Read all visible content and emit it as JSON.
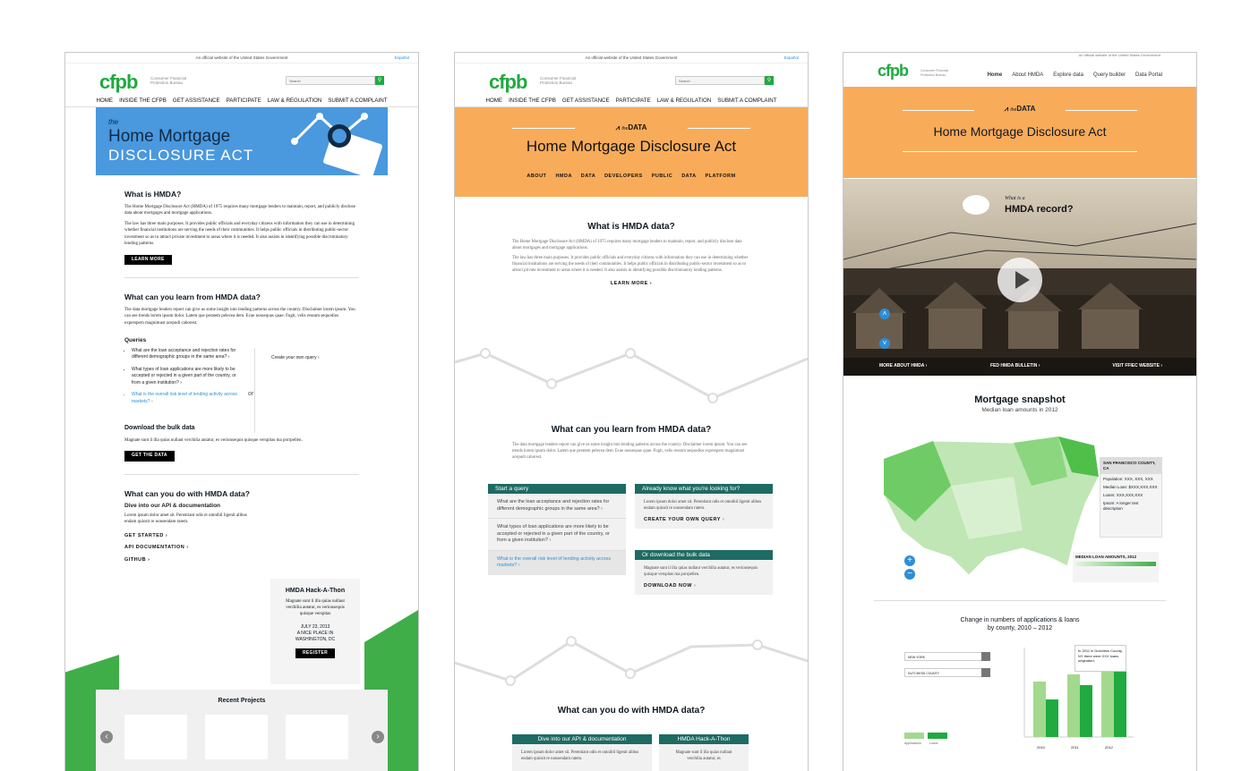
{
  "common": {
    "gov_banner": "An official website of the United States Government",
    "espanol": "Español",
    "logo": "cfpb",
    "logo_sub": "Consumer Financial Protection Bureau",
    "search_placeholder": "Search",
    "nav": [
      "HOME",
      "INSIDE THE CFPB",
      "GET ASSISTANCE",
      "PARTICIPATE",
      "LAW & REGULATION",
      "SUBMIT A COMPLAINT"
    ]
  },
  "panel1": {
    "hero_the": "the",
    "hero_title1": "Home Mortgage",
    "hero_title2": "DISCLOSURE ACT",
    "what_heading": "What is HMDA?",
    "what_p1": "The Home Mortgage Disclosure Act (HMDA) of 1975 requires many mortgage lenders to maintain, report, and publicly disclose data about mortgages and mortgage applications.",
    "what_p2": "The law has three main purposes. It provides public officials and everyday citizens with information they can use in determining whether financial institutions are serving the needs of their communities. It helps public officials in distributing public-sector investment so as to attract private investment to areas where it is needed. It also assists in identifying possible discriminatory lending patterns.",
    "learn_more": "LEARN MORE",
    "learn_heading": "What can you learn from HMDA data?",
    "learn_p": "The data mortgage lenders report can give us some insight into lending patterns across the country. Disclaimer lorem ipsum. You can see trends lorem ipsum dolor. Latem que peratem pelecea dem. Ecae nossequas quae. Fugit, velis ressum sequodios experspero magnimust acepudi caborest.",
    "queries_heading": "Queries",
    "queries": [
      "What are the loan acceptance and rejection rates for different demographic groups in the same area?",
      "What types of loan applications are more likely to be accepted or rejected in a given part of the country, or from a given institution?",
      "What is the overall risk level of lending activity across markets?"
    ],
    "or": "or",
    "create_query": "Create your own query",
    "bulk_heading": "Download the bulk data",
    "bulk_p": "Magnate sunt il illa quias nullaut verchilia autatur, es verionsequis quisque verspitas ma porrpellen.",
    "get_data": "GET THE DATA",
    "do_heading": "What can you do with HMDA data?",
    "api_heading": "Dive into our API & documentation",
    "api_p": "Lorem ipsum dolor amet sit. Perentiant odis et omnibil ligenit alibus endam quiosit re nonsendam ratem.",
    "get_started": "GET STARTED",
    "api_doc": "API DOCUMENTATION",
    "github": "GITHUB",
    "hack_title": "HMDA Hack-A-Thon",
    "hack_p": "Magnate sunt il illa quias nullaut verchilia autatur, es veriousequis quisque verspitas",
    "hack_date": "JULY 23, 2013",
    "hack_place": "A NICE PLACE IN WASHINGTON, DC",
    "register": "REGISTER",
    "recent": "Recent Projects"
  },
  "panel2": {
    "the_data": "DATA",
    "the": "the",
    "title": "Home Mortgage Disclosure Act",
    "subnav": [
      "ABOUT",
      "HMDA DATA",
      "DEVELOPERS",
      "PUBLIC DATA PLATFORM"
    ],
    "what_heading": "What is HMDA data?",
    "what_p1": "The Home Mortgage Disclosure Act (HMDA) of 1975 requires many mortgage lenders to maintain, report, and publicly disclose data about mortgages and mortgage applications.",
    "what_p2": "The law has three main purposes. It provides public officials and everyday citizens with information they can use in determining whether financial institutions are serving the needs of their communities. It helps public officials in distributing public-sector investment so as to attract private investment to areas where it is needed. It also assists in identifying possible discriminatory lending patterns.",
    "learn_more": "LEARN MORE",
    "learn_heading": "What can you learn from HMDA data?",
    "learn_p": "The data mortgage lenders report can give us some insight into lending patterns across the country. Disclaimer lorem ipsum. You can see trends lorem ipsum dolor. Latem que peratem pelecea dem. Ecae nossequas quae. Fugit, velis ressum sequodios experspero magnimust acepudi caborest.",
    "start_query": "Start a query",
    "q1": "What are the loan acceptance and rejection rates for different demographic groups in the same area?",
    "q2": "What types of loan applications are more likely to be accepted or rejected in a given part of the country, or from a given institution?",
    "q3": "What is the overall risk level of lending activity across markets?",
    "know": "Already know what you're looking for?",
    "know_p": "Lorem ipsum dolor amet sit. Perentiant odis et omnibil ligenit alibus endam quiosit re nonsendam ratem.",
    "create_own": "CREATE YOUR OWN QUERY",
    "bulk": "Or download the bulk data",
    "bulk_p": "Magnate sunt il illa quias nullaut verchilia autatur, es verionsequis quisque verspitas ma porrpellen.",
    "download_now": "DOWNLOAD NOW",
    "do_heading": "What can you do with HMDA data?",
    "api_heading": "Dive into our API & documentation",
    "api_p": "Lorem ipsum dolor amet sit. Perentiant odis et omnibil ligenit alibus endam quiosit re nonsendam ratem.",
    "hack_title": "HMDA Hack-A-Thon",
    "hack_p": "Magnate sunt il illa quias nullaut verchilia autatur, es"
  },
  "panel3": {
    "gov_banner": "An official website of the United States Government",
    "nav": [
      "Home",
      "About HMDA",
      "Explore data",
      "Query builder",
      "Data Portal"
    ],
    "the": "the",
    "data": "DATA",
    "title": "Home Mortgage Disclosure Act",
    "what_is_a": "What is a",
    "record": "HMDA record?",
    "video_links": [
      "MORE ABOUT HMDA",
      "FED HMDA BULLETIN",
      "VISIT FFIEC WEBSITE"
    ],
    "snapshot_title": "Mortgage snapshot",
    "snapshot_sub": "Median loan amounts in 2012",
    "tooltip_title": "SAN FRANCISCO COUNTY, CA",
    "tooltip_pop": "Population: XXX, XXX, XXX",
    "tooltip_median": "Median Loan: $XXX,XXX,XXX",
    "tooltip_loans": "Loans: XXX,XXX,XXX",
    "tooltip_ipsum": "Ipsum: A longer text description",
    "legend_title": "MEDIAN LOAN AMOUNTS, 2012",
    "change_title": "Change in numbers of applications & loans",
    "change_sub": "by county, 2010 – 2012",
    "select1": "NEW YORK",
    "select2": "DUTCHESS COUNTY",
    "callout": "In 2011 in Dutchess County, NY there were XXX loans originated.",
    "legend_apps": "Applications",
    "legend_loans": "Loans",
    "years": [
      "2010",
      "2011",
      "2012"
    ],
    "accent_green": "#20aa3f",
    "accent_orange": "#f8ac5a",
    "accent_teal": "#1e6b63"
  }
}
